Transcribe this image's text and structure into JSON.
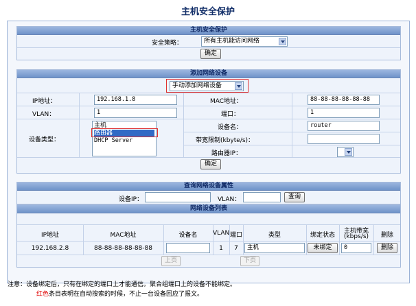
{
  "page_title": "主机安全保护",
  "security": {
    "header": "主机安全保护",
    "policy_label": "安全策略：",
    "policy_value": "所有主机能访问网络",
    "confirm": "确定"
  },
  "add_device": {
    "header": "添加网络设备",
    "mode_value": "手动添加网络设备",
    "ip_label": "IP地址：",
    "ip_value": "192.168.1.8",
    "mac_label": "MAC地址：",
    "mac_value": "88-88-88-88-88-88",
    "vlan_label": "VLAN：",
    "vlan_value": "1",
    "port_label": "端口：",
    "port_value": "1",
    "type_label": "设备类型：",
    "type_options": [
      "主机",
      "路由器",
      "DHCP Server"
    ],
    "type_selected": "路由器",
    "name_label": "设备名：",
    "name_value": "router",
    "bandwidth_label": "带宽限制(kbyte/s)：",
    "bandwidth_value": "",
    "router_ip_label": "路由器IP：",
    "router_ip_value": "",
    "confirm": "确定"
  },
  "query": {
    "header": "查询网络设备属性",
    "ip_label": "设备IP：",
    "ip_value": "",
    "vlan_label": "VLAN：",
    "vlan_value": "",
    "button": "查询"
  },
  "device_list": {
    "header": "网络设备列表",
    "columns": [
      "IP地址",
      "MAC地址",
      "设备名",
      "VLAN",
      "端口",
      "类型",
      "绑定状态",
      "主机带宽",
      "(kbps/s)",
      "删除"
    ],
    "rows": [
      {
        "ip": "192.168.2.8",
        "mac": "88-88-88-88-88-88",
        "name": "",
        "vlan": "1",
        "port": "7",
        "type": "主机",
        "bind_button": "未绑定",
        "bandwidth": "0",
        "delete_button": "删除"
      }
    ],
    "prev_page": "上页",
    "next_page": "下页"
  },
  "notes": {
    "line1": "注意：设备绑定后，只有在绑定的端口上才能通信。聚合组端口上的设备不能绑定。",
    "line2_red": "红色",
    "line2_rest": "条目表明在自动搜索的时候，不止一台设备回应了报文。"
  },
  "colors": {
    "header_bg": "#7d9ed0",
    "header_text": "#102a66",
    "panel_bg": "#eef3fb",
    "highlight_border": "#e03030",
    "note_red": "#e00000"
  }
}
